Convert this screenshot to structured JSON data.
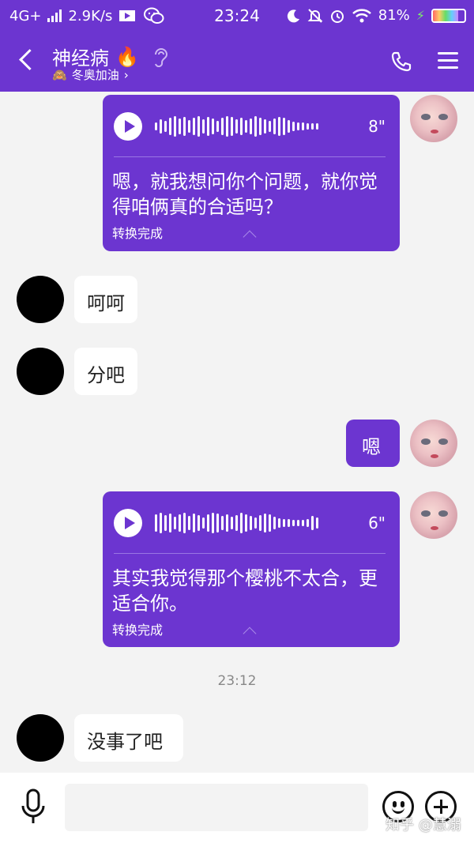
{
  "status_bar": {
    "network": "4G+",
    "speed": "2.9K/s",
    "time": "23:24",
    "battery": "81%",
    "battery_level": 0.81
  },
  "header": {
    "contact_name": "神经病",
    "flame": "🔥",
    "subtitle_emoji": "🙈",
    "subtitle": "冬奥加油",
    "subtitle_arrow": "›"
  },
  "messages": [
    {
      "from": "me",
      "type": "voice",
      "duration": "8\"",
      "transcript": "嗯，就我想问你个问题，就你觉得咱俩真的合适吗？",
      "status": "转换完成"
    },
    {
      "from": "other",
      "type": "text",
      "text": "呵呵"
    },
    {
      "from": "other",
      "type": "text",
      "text": "分吧"
    },
    {
      "from": "me",
      "type": "text",
      "text": "嗯"
    },
    {
      "from": "me",
      "type": "voice",
      "duration": "6\"",
      "transcript": "其实我觉得那个樱桃不太合，更适合你。",
      "status": "转换完成"
    },
    {
      "from": "other",
      "type": "text",
      "text": "没事了吧"
    }
  ],
  "timestamp": "23:12",
  "watermark": "知乎 @慧溺",
  "colors": {
    "accent": "#6c35d0",
    "background": "#f3f3f3"
  },
  "icons": [
    "back-arrow-icon",
    "ear-icon",
    "phone-icon",
    "menu-icon",
    "microphone-icon",
    "emoji-icon",
    "plus-icon"
  ]
}
